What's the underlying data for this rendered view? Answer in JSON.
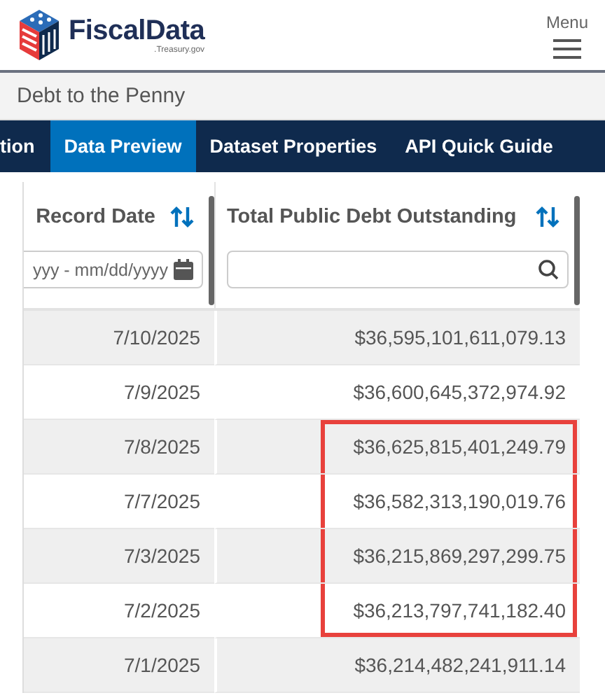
{
  "header": {
    "logo": "FiscalData",
    "logo_sub": ".Treasury.gov",
    "menu_label": "Menu"
  },
  "breadcrumb": "Debt to the Penny",
  "tabs": [
    {
      "label": "tion",
      "selected": false
    },
    {
      "label": "Data Preview",
      "selected": true
    },
    {
      "label": "Dataset Properties",
      "selected": false
    },
    {
      "label": "API Quick Guide",
      "selected": false
    }
  ],
  "table": {
    "columns": [
      {
        "label": "Record Date",
        "filter": {
          "kind": "date",
          "placeholder": "yyy - mm/dd/yyyy"
        }
      },
      {
        "label": "Total Public Debt Outstanding",
        "filter": {
          "kind": "search"
        }
      }
    ],
    "rows": [
      {
        "cells": [
          "7/10/2025",
          "$36,595,101,611,079.13"
        ],
        "highlighted": false
      },
      {
        "cells": [
          "7/9/2025",
          "$36,600,645,372,974.92"
        ],
        "highlighted": false
      },
      {
        "cells": [
          "7/8/2025",
          "$36,625,815,401,249.79"
        ],
        "highlighted": true
      },
      {
        "cells": [
          "7/7/2025",
          "$36,582,313,190,019.76"
        ],
        "highlighted": true
      },
      {
        "cells": [
          "7/3/2025",
          "$36,215,869,297,299.75"
        ],
        "highlighted": true
      },
      {
        "cells": [
          "7/2/2025",
          "$36,213,797,741,182.40"
        ],
        "highlighted": true
      },
      {
        "cells": [
          "7/1/2025",
          "$36,214,482,241,911.14"
        ],
        "highlighted": false
      }
    ]
  }
}
